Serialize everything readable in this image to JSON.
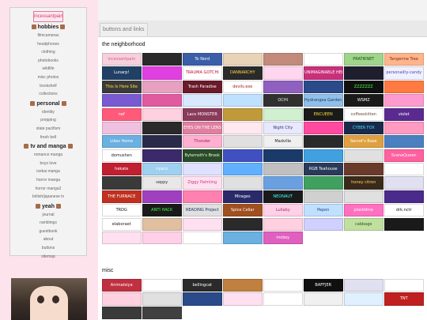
{
  "sidebar": {
    "site_title": "incessantpain",
    "groups": [
      {
        "heading": "hobbies",
        "items": [
          "filmcameras",
          "headphones",
          "clothing",
          "photobooks",
          "wildlife",
          "misc photos",
          "bookshelf",
          "collections"
        ]
      },
      {
        "heading": "personal",
        "items": [
          "identity",
          "prepping",
          "state pacifism",
          "fresh bell"
        ]
      },
      {
        "heading": "tv and manga",
        "items": [
          "romance manga",
          "boys love",
          "isekai manga",
          "horror manga",
          "horror manga2",
          "british/japanese tv"
        ]
      },
      {
        "heading": "yeah",
        "items": [
          "journal",
          "ramblings",
          "guestbook",
          "about",
          "buttons",
          "sitemap"
        ]
      }
    ]
  },
  "tab": {
    "label": "buttons and links"
  },
  "sections": [
    {
      "title": "the neighborhood",
      "buttons": [
        {
          "text": "incessantpain",
          "bg": "#f6d0dc",
          "fg": "#e05a8a"
        },
        {
          "text": "",
          "bg": "#2a2a2a",
          "fg": "#ffffff"
        },
        {
          "text": "To Nord",
          "bg": "#3b5ea8",
          "fg": "#ffffff"
        },
        {
          "text": "",
          "bg": "#e9d3b8",
          "fg": "#5a3b2a"
        },
        {
          "text": "",
          "bg": "#c28a7a",
          "fg": "#ffffff"
        },
        {
          "text": "",
          "bg": "#ffffff",
          "fg": "#444444"
        },
        {
          "text": "PRATIKNET",
          "bg": "#9fd58a",
          "fg": "#234a16"
        },
        {
          "text": "Tangerine Tree",
          "bg": "#ffb58c",
          "fg": "#7a2a10"
        },
        {
          "text": "Lunarp!",
          "bg": "#224066",
          "fg": "#ffffff"
        },
        {
          "text": "",
          "bg": "#e040e0",
          "fg": "#ffffff"
        },
        {
          "text": "TRAUMA GOTCHI",
          "bg": "#ffffff",
          "fg": "#c01030"
        },
        {
          "text": "DANNARCHY",
          "bg": "#2a2a2a",
          "fg": "#ffd84a"
        },
        {
          "text": "",
          "bg": "#ffd6f0",
          "fg": "#a0206a"
        },
        {
          "text": "UNIMAGINABLE HEIGHTS",
          "bg": "#c8307a",
          "fg": "#ffffff"
        },
        {
          "text": "",
          "bg": "#1e1e2e",
          "fg": "#ffffff"
        },
        {
          "text": "personality-candy",
          "bg": "#f0f0ff",
          "fg": "#4050a0"
        },
        {
          "text": "This Is Here Site",
          "bg": "#3a3a3a",
          "fg": "#ffe040"
        },
        {
          "text": "",
          "bg": "#e8a0c0",
          "fg": "#ffffff"
        },
        {
          "text": "Trash Paradise",
          "bg": "#6a1a2a",
          "fg": "#ffffff"
        },
        {
          "text": "devils.exe",
          "bg": "#ffffff",
          "fg": "#a02020"
        },
        {
          "text": "",
          "bg": "#9060c0",
          "fg": "#ffffff"
        },
        {
          "text": "",
          "bg": "#2a4a8a",
          "fg": "#ffffff"
        },
        {
          "text": "ZZZZZZZ",
          "bg": "#101010",
          "fg": "#40ff40"
        },
        {
          "text": "",
          "bg": "#ff7a40",
          "fg": "#ffffff"
        },
        {
          "text": "",
          "bg": "#7a5ad0",
          "fg": "#ffffff"
        },
        {
          "text": "",
          "bg": "#e05aa0",
          "fg": "#ffffff"
        },
        {
          "text": "",
          "bg": "#d8e8ff",
          "fg": "#3050a0"
        },
        {
          "text": "",
          "bg": "#c0e0ff",
          "fg": "#204080"
        },
        {
          "text": "OCHI",
          "bg": "#303030",
          "fg": "#f0f0f0"
        },
        {
          "text": "Hydrangea Garden",
          "bg": "#90c0e8",
          "fg": "#1a3a6a"
        },
        {
          "text": "WSMZ",
          "bg": "#1a1a1a",
          "fg": "#ffffff"
        },
        {
          "text": "",
          "bg": "#ff9ad0",
          "fg": "#ffffff"
        },
        {
          "text": "nef",
          "bg": "#ff5a7a",
          "fg": "#ffffff"
        },
        {
          "text": "",
          "bg": "#ffd0e0",
          "fg": "#c04070"
        },
        {
          "text": "Lace MONSTER",
          "bg": "#8a3a5a",
          "fg": "#ffffff"
        },
        {
          "text": "",
          "bg": "#c09a3a",
          "fg": "#ffffff"
        },
        {
          "text": "",
          "bg": "#d0f0d0",
          "fg": "#306030"
        },
        {
          "text": "ENCUEEN",
          "bg": "#1a1a1a",
          "fg": "#ffdd40"
        },
        {
          "text": "coffeeskitten",
          "bg": "#ffffff",
          "fg": "#6a4a3a"
        },
        {
          "text": "violet",
          "bg": "#5a2a90",
          "fg": "#ffffff"
        },
        {
          "text": "",
          "bg": "#f0c0e0",
          "fg": "#8a2060"
        },
        {
          "text": "",
          "bg": "#2a2a2a",
          "fg": "#ffffff"
        },
        {
          "text": "EYES ON THE LENS",
          "bg": "#e080a0",
          "fg": "#ffffff"
        },
        {
          "text": "",
          "bg": "#ffe8f0",
          "fg": "#c04070"
        },
        {
          "text": "Night City",
          "bg": "#e8e8ff",
          "fg": "#303060"
        },
        {
          "text": "",
          "bg": "#ff4aa0",
          "fg": "#ffffff"
        },
        {
          "text": "CYBER FOX",
          "bg": "#1a2a4a",
          "fg": "#40e0ff"
        },
        {
          "text": "",
          "bg": "#ff9ac0",
          "fg": "#ffffff"
        },
        {
          "text": "Likes Home",
          "bg": "#6ab0e0",
          "fg": "#ffffff"
        },
        {
          "text": "",
          "bg": "#2a2a4a",
          "fg": "#ffffff"
        },
        {
          "text": "Thonder",
          "bg": "#ffb0d0",
          "fg": "#a02060"
        },
        {
          "text": "",
          "bg": "#e0e0e0",
          "fg": "#303030"
        },
        {
          "text": "Madville",
          "bg": "#f0f0f0",
          "fg": "#202020"
        },
        {
          "text": "",
          "bg": "#2a2a2a",
          "fg": "#ffffff"
        },
        {
          "text": "Secret's Base",
          "bg": "#e0a040",
          "fg": "#ffffff"
        },
        {
          "text": "",
          "bg": "#4a80c0",
          "fg": "#ffffff"
        },
        {
          "text": "domushen",
          "bg": "#ffffff",
          "fg": "#202020"
        },
        {
          "text": "",
          "bg": "#3a2a6a",
          "fg": "#ffffff"
        },
        {
          "text": "Bytemoth's Brook",
          "bg": "#2a4a2a",
          "fg": "#e0ffe0"
        },
        {
          "text": "",
          "bg": "#4050c0",
          "fg": "#ffffff"
        },
        {
          "text": "",
          "bg": "#1a3a6a",
          "fg": "#ffffff"
        },
        {
          "text": "",
          "bg": "#40a0e0",
          "fg": "#ffffff"
        },
        {
          "text": "",
          "bg": "#e0e0e0",
          "fg": "#404040"
        },
        {
          "text": "SceneQueen",
          "bg": "#ff60a0",
          "fg": "#ffffff"
        },
        {
          "text": "hekate",
          "bg": "#c02030",
          "fg": "#ffffff"
        },
        {
          "text": "nyaco",
          "bg": "#a0d0f0",
          "fg": "#ffffff"
        },
        {
          "text": "",
          "bg": "#e0e0ff",
          "fg": "#303060"
        },
        {
          "text": "",
          "bg": "#60b0ff",
          "fg": "#ffffff"
        },
        {
          "text": "",
          "bg": "#c0c0c0",
          "fg": "#303030"
        },
        {
          "text": "RGB Teahouse",
          "bg": "#2a3a5a",
          "fg": "#ffffff"
        },
        {
          "text": "",
          "bg": "#6a3a2a",
          "fg": "#ffffff"
        },
        {
          "text": "",
          "bg": "#ffffff",
          "fg": "#303030"
        },
        {
          "text": "",
          "bg": "#3a3a3a",
          "fg": "#ffffff"
        },
        {
          "text": "seppy",
          "bg": "#e8e8e8",
          "fg": "#303030"
        },
        {
          "text": "Ziggy Palmling",
          "bg": "#ffe0f0",
          "fg": "#c04080"
        },
        {
          "text": "",
          "bg": "#e0e0e0",
          "fg": "#404040"
        },
        {
          "text": "",
          "bg": "#6aa0e0",
          "fg": "#ffffff"
        },
        {
          "text": "",
          "bg": "#40a060",
          "fg": "#ffffff"
        },
        {
          "text": "honey citron",
          "bg": "#3a2a1a",
          "fg": "#ffd060"
        },
        {
          "text": "",
          "bg": "#e0e0f0",
          "fg": "#303060"
        },
        {
          "text": "THE FURNACE",
          "bg": "#c03020",
          "fg": "#ffffff"
        },
        {
          "text": "",
          "bg": "#a040c0",
          "fg": "#ffffff"
        },
        {
          "text": "",
          "bg": "#ff80b0",
          "fg": "#ffffff"
        },
        {
          "text": "Mirages",
          "bg": "#2a2a6a",
          "fg": "#ffffff"
        },
        {
          "text": "NEONAUT",
          "bg": "#1a1a1a",
          "fg": "#40ffff"
        },
        {
          "text": "",
          "bg": "#d0d0d0",
          "fg": "#303030"
        },
        {
          "text": "",
          "bg": "#e0e0e0",
          "fg": "#303030"
        },
        {
          "text": "",
          "bg": "#4a2a8a",
          "fg": "#ffffff"
        },
        {
          "text": "TRDG",
          "bg": "#ffffff",
          "fg": "#101010"
        },
        {
          "text": "ANTI HACK",
          "bg": "#1a1a1a",
          "fg": "#40ff40"
        },
        {
          "text": "READING Project",
          "bg": "#e0e0e0",
          "fg": "#203060"
        },
        {
          "text": "Spice Cellar",
          "bg": "#a05020",
          "fg": "#ffffff"
        },
        {
          "text": "Lullaby",
          "bg": "#ffd0e8",
          "fg": "#a03070"
        },
        {
          "text": "Pepon",
          "bg": "#c0e0ff",
          "fg": "#204080"
        },
        {
          "text": "plastidine",
          "bg": "#ff70c0",
          "fg": "#ffffff"
        },
        {
          "text": "drk.nctr",
          "bg": "#ffffff",
          "fg": "#101010"
        },
        {
          "text": "elaboraet",
          "bg": "#ffffff",
          "fg": "#202020"
        },
        {
          "text": "",
          "bg": "#e0c0a0",
          "fg": "#604020"
        },
        {
          "text": "",
          "bg": "#ffe0f0",
          "fg": "#c04080"
        },
        {
          "text": "",
          "bg": "#2a2a2a",
          "fg": "#ffffff"
        },
        {
          "text": "",
          "bg": "#ffd0e0",
          "fg": "#c04070"
        },
        {
          "text": "",
          "bg": "#d0d0ff",
          "fg": "#303080"
        },
        {
          "text": "cabbage",
          "bg": "#c0e0a0",
          "fg": "#305020"
        },
        {
          "text": "",
          "bg": "#1a1a1a",
          "fg": "#ffffff"
        },
        {
          "text": "",
          "bg": "#ffe0f0",
          "fg": "#c04080"
        },
        {
          "text": "",
          "bg": "#ffd0e8",
          "fg": "#c04080"
        },
        {
          "text": "",
          "bg": "#ffffff",
          "fg": "#303030"
        },
        {
          "text": "",
          "bg": "#6ab0e0",
          "fg": "#ffffff"
        },
        {
          "text": "mobsy",
          "bg": "#e060c0",
          "fg": "#ffffff"
        }
      ]
    },
    {
      "title": "misc",
      "buttons": [
        {
          "text": "Animatsiya",
          "bg": "#c03040",
          "fg": "#ffffff"
        },
        {
          "text": "",
          "bg": "#ffffff",
          "fg": "#202020"
        },
        {
          "text": "bellingcat",
          "bg": "#2a2a2a",
          "fg": "#ffffff"
        },
        {
          "text": "",
          "bg": "#c08040",
          "fg": "#ffffff"
        },
        {
          "text": "",
          "bg": "#ffffff",
          "fg": "#303030"
        },
        {
          "text": "BAFFJER",
          "bg": "#101010",
          "fg": "#ffffff"
        },
        {
          "text": "",
          "bg": "#e0e0f0",
          "fg": "#303060"
        },
        {
          "text": "",
          "bg": "#ffffff",
          "fg": "#101010"
        },
        {
          "text": "",
          "bg": "#ffd0e0",
          "fg": "#c04070"
        },
        {
          "text": "",
          "bg": "#e0e0e0",
          "fg": "#303030"
        },
        {
          "text": "",
          "bg": "#2a4a8a",
          "fg": "#ffffff"
        },
        {
          "text": "",
          "bg": "#ffe0f0",
          "fg": "#c04080"
        },
        {
          "text": "",
          "bg": "#ffffff",
          "fg": "#303030"
        },
        {
          "text": "",
          "bg": "#f0f0f0",
          "fg": "#303030"
        },
        {
          "text": "",
          "bg": "#e0f0ff",
          "fg": "#304060"
        },
        {
          "text": "TNT",
          "bg": "#c02020",
          "fg": "#ffffff"
        },
        {
          "text": "",
          "bg": "#3a3a3a",
          "fg": "#ffffff"
        },
        {
          "text": "",
          "bg": "#404040",
          "fg": "#ffffff"
        }
      ]
    }
  ]
}
